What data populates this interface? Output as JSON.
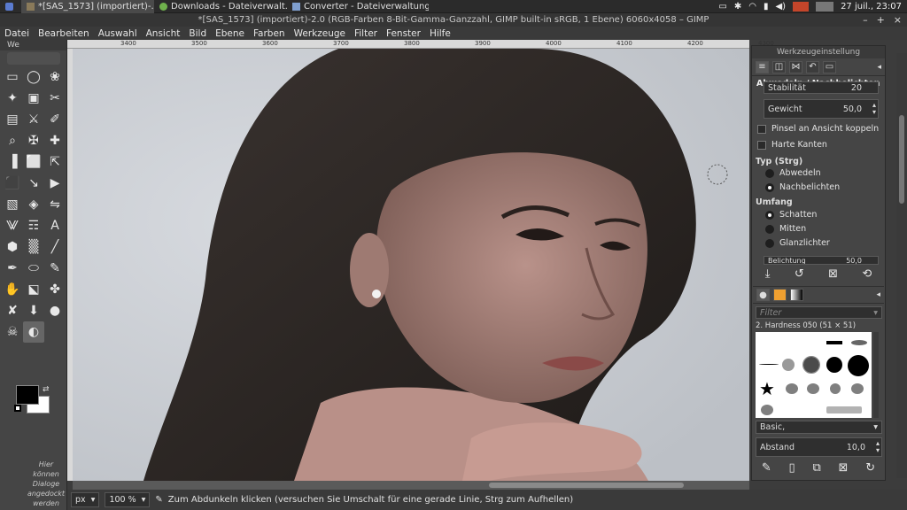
{
  "taskbar": {
    "tasks": [
      {
        "label": "*[SAS_1573] (importiert)-..."
      },
      {
        "label": "Downloads - Dateiverwalt..."
      },
      {
        "label": "Converter - Dateiverwaltung"
      }
    ],
    "clock": "27 juil., 23:07"
  },
  "window": {
    "title": "*[SAS_1573] (importiert)-2.0 (RGB-Farben 8-Bit-Gamma-Ganzzahl, GIMP built-in sRGB, 1 Ebene) 6060x4058 – GIMP",
    "controls": [
      "–",
      "+",
      "×"
    ]
  },
  "menubar": [
    "Datei",
    "Bearbeiten",
    "Auswahl",
    "Ansicht",
    "Bild",
    "Ebene",
    "Farben",
    "Werkzeuge",
    "Filter",
    "Fenster",
    "Hilfe"
  ],
  "toolbox": {
    "title": "We",
    "hint": "Hier können Dialoge angedockt werden",
    "tools": [
      "▭",
      "◯",
      "❀",
      "✦",
      "▣",
      "✂",
      "▤",
      "⚔",
      "✐",
      "⌕",
      "✠",
      "✚",
      "▐",
      "⬜",
      "⇱",
      "⬛",
      "↘",
      "▶",
      "▧",
      "◈",
      "⇋",
      "⨈",
      "☶",
      "A",
      "⬢",
      "▒",
      "╱",
      "✒",
      "⬭",
      "✎",
      "✋",
      "⬕",
      "✤",
      "✘",
      "⬇",
      "●",
      "☠",
      "◐"
    ]
  },
  "ruler": {
    "labels": [
      "3400",
      "3500",
      "3600",
      "3700",
      "3800",
      "3900",
      "4000",
      "4100",
      "4200",
      "4300"
    ]
  },
  "status": {
    "unit": "px",
    "zoom": "100 %",
    "message": "Zum Abdunkeln klicken (versuchen Sie Umschalt für eine gerade Linie, Strg zum Aufhellen)"
  },
  "tool_options": {
    "dock_title": "Werkzeugeinstellung",
    "tool_name": "Abwedeln / Nachbelichten",
    "partial_top": "Stabilität",
    "partial_top_value": "20",
    "weight_label": "Gewicht",
    "weight_value": "50,0",
    "link_brush_label": "Pinsel an Ansicht koppeln",
    "hard_edges_label": "Harte Kanten",
    "type_label": "Typ (Strg)",
    "type_options": [
      "Abwedeln",
      "Nachbelichten"
    ],
    "type_selected": 1,
    "range_label": "Umfang",
    "range_options": [
      "Schatten",
      "Mitten",
      "Glanzlichter"
    ],
    "range_selected": 0,
    "exposure_label": "Belichtung",
    "exposure_value": "50,0"
  },
  "brushes": {
    "filter_placeholder": "Filter",
    "current": "2. Hardness 050 (51 × 51)",
    "tag": "Basic,",
    "spacing_label": "Abstand",
    "spacing_value": "10,0"
  }
}
